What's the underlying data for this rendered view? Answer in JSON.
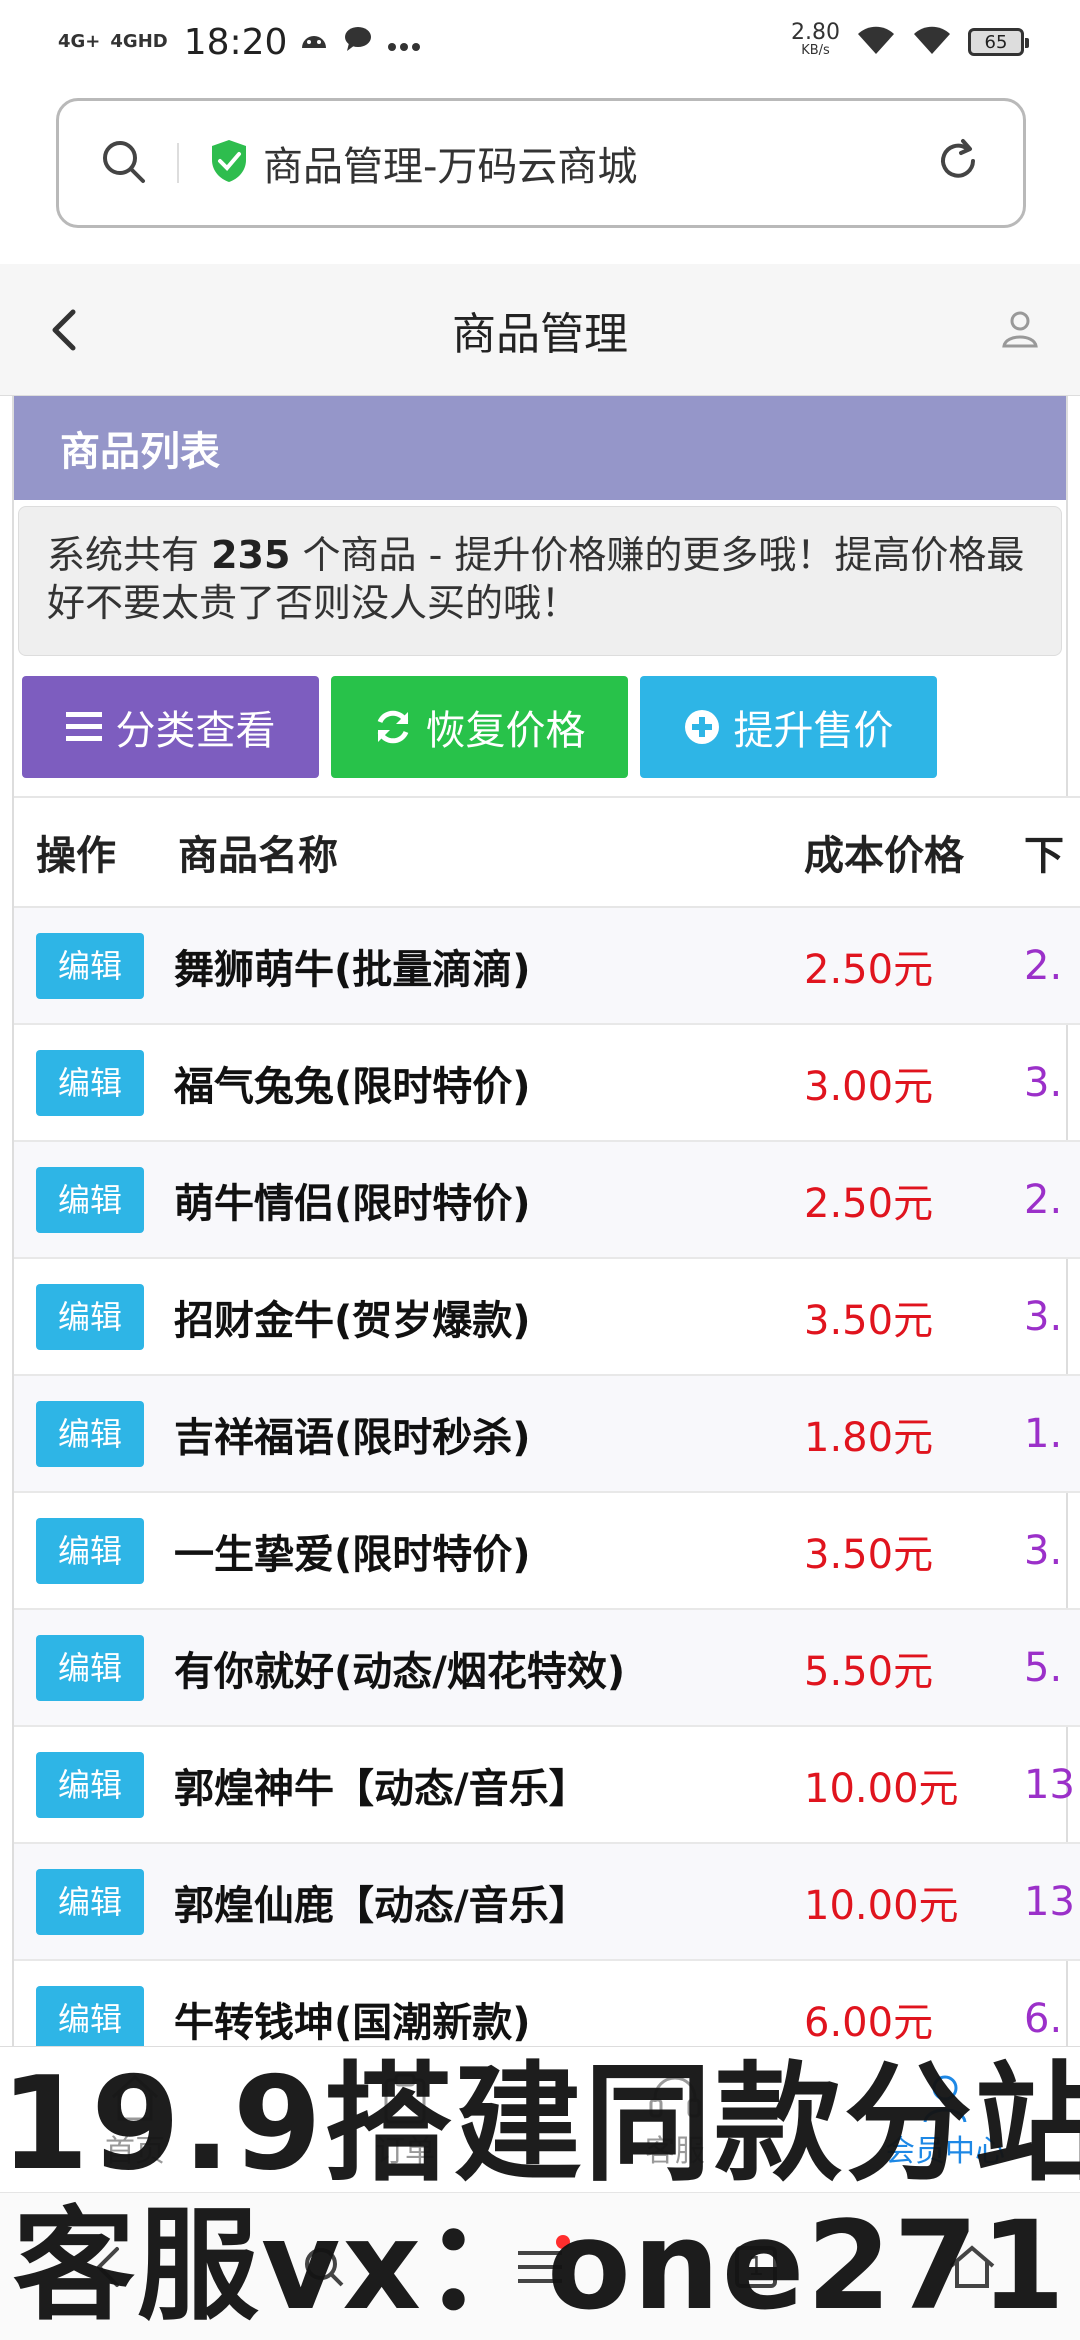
{
  "status_bar": {
    "network_1": "4G+",
    "network_2": "4GHD",
    "time": "18:20",
    "speed_value": "2.80",
    "speed_unit": "KB/s",
    "battery": "65"
  },
  "browser": {
    "url_title": "商品管理-万码云商城"
  },
  "header": {
    "title": "商品管理"
  },
  "panel": {
    "heading": "商品列表",
    "notice_prefix": "系统共有",
    "notice_count": "235",
    "notice_suffix": "个商品 - 提升价格赚的更多哦！提高价格最好不要太贵了否则没人买的哦！"
  },
  "actions": {
    "category_label": "分类查看",
    "restore_label": "恢复价格",
    "raise_label": "提升售价"
  },
  "table": {
    "headers": [
      "操作",
      "商品名称",
      "成本价格",
      "下"
    ],
    "edit_label": "编辑",
    "rows": [
      {
        "name": "舞狮萌牛(批量滴滴)",
        "cost": "2.50元",
        "next": "2."
      },
      {
        "name": "福气兔兔(限时特价)",
        "cost": "3.00元",
        "next": "3."
      },
      {
        "name": "萌牛情侣(限时特价)",
        "cost": "2.50元",
        "next": "2."
      },
      {
        "name": "招财金牛(贺岁爆款)",
        "cost": "3.50元",
        "next": "3."
      },
      {
        "name": "吉祥福语(限时秒杀)",
        "cost": "1.80元",
        "next": "1."
      },
      {
        "name": "一生挚爱(限时特价)",
        "cost": "3.50元",
        "next": "3."
      },
      {
        "name": "有你就好(动态/烟花特效)",
        "cost": "5.50元",
        "next": "5."
      },
      {
        "name": "郭煌神牛【动态/音乐】",
        "cost": "10.00元",
        "next": "13"
      },
      {
        "name": "郭煌仙鹿【动态/音乐】",
        "cost": "10.00元",
        "next": "13"
      },
      {
        "name": "牛转钱坤(国潮新款)",
        "cost": "6.00元",
        "next": "6."
      }
    ]
  },
  "tabbar": {
    "home": "首页",
    "order": "订单",
    "service": "客服",
    "member": "会员中心"
  },
  "navbar": {
    "tabs_count": "1"
  },
  "watermark": {
    "line1": "19.9搭建同款分站",
    "line2": "客服vx：one271"
  },
  "colors": {
    "panel_head": "#9596c9",
    "category_btn": "#7d5dbf",
    "restore_btn": "#28c24a",
    "raise_btn": "#2eb5e6",
    "cost_text": "#e0141e",
    "next_text": "#9b30c9"
  }
}
